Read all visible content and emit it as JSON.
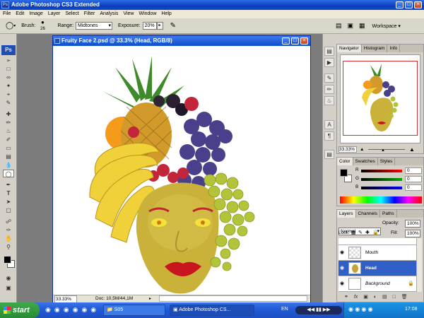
{
  "window": {
    "title": "Adobe Photoshop CS3 Extended",
    "app_logo": "Ps"
  },
  "menu": [
    "File",
    "Edit",
    "Image",
    "Layer",
    "Select",
    "Filter",
    "Analysis",
    "View",
    "Window",
    "Help"
  ],
  "options": {
    "brush_label": "Brush:",
    "brush_size": "26",
    "range_label": "Range:",
    "range_value": "Midtones",
    "exposure_label": "Exposure:",
    "exposure_value": "20%",
    "workspace_label": "Workspace"
  },
  "document": {
    "title": "Fruity Face 2.psd @ 33.3% (Head, RGB/8)",
    "zoom": "33.33%",
    "doc_info": "Doc: 10,5M/44,1M"
  },
  "navigator": {
    "tabs": [
      "Navigator",
      "Histogram",
      "Info"
    ],
    "zoom": "33.33%"
  },
  "color": {
    "tabs": [
      "Color",
      "Swatches",
      "Styles"
    ],
    "channels": [
      {
        "label": "R",
        "value": "0"
      },
      {
        "label": "G",
        "value": "0"
      },
      {
        "label": "B",
        "value": "0"
      }
    ]
  },
  "layers": {
    "tabs": [
      "Layers",
      "Channels",
      "Paths"
    ],
    "blend_mode": "Normal",
    "opacity_label": "Opacity:",
    "opacity": "100%",
    "lock_label": "Lock:",
    "fill_label": "Fill:",
    "fill": "100%",
    "items": [
      {
        "name": "Mouth"
      },
      {
        "name": "Head"
      },
      {
        "name": "Background"
      }
    ]
  },
  "taskbar": {
    "start": "start",
    "items": [
      "S05",
      "Adobe Photoshop CS..."
    ],
    "lang": "EN",
    "time": "17:08"
  }
}
